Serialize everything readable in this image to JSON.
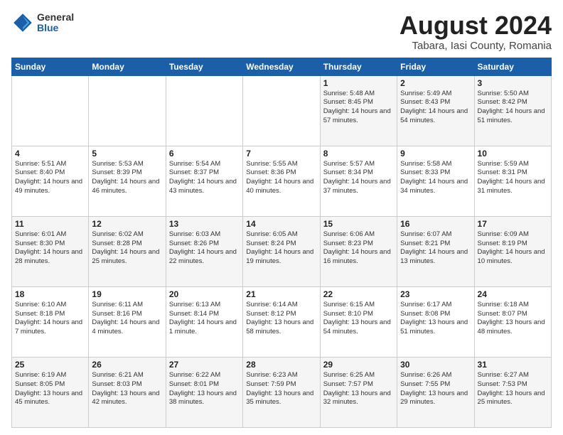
{
  "logo": {
    "general": "General",
    "blue": "Blue"
  },
  "title": {
    "main": "August 2024",
    "sub": "Tabara, Iasi County, Romania"
  },
  "days_of_week": [
    "Sunday",
    "Monday",
    "Tuesday",
    "Wednesday",
    "Thursday",
    "Friday",
    "Saturday"
  ],
  "weeks": [
    [
      {
        "day": "",
        "info": ""
      },
      {
        "day": "",
        "info": ""
      },
      {
        "day": "",
        "info": ""
      },
      {
        "day": "",
        "info": ""
      },
      {
        "day": "1",
        "info": "Sunrise: 5:48 AM\nSunset: 8:45 PM\nDaylight: 14 hours\nand 57 minutes."
      },
      {
        "day": "2",
        "info": "Sunrise: 5:49 AM\nSunset: 8:43 PM\nDaylight: 14 hours\nand 54 minutes."
      },
      {
        "day": "3",
        "info": "Sunrise: 5:50 AM\nSunset: 8:42 PM\nDaylight: 14 hours\nand 51 minutes."
      }
    ],
    [
      {
        "day": "4",
        "info": "Sunrise: 5:51 AM\nSunset: 8:40 PM\nDaylight: 14 hours\nand 49 minutes."
      },
      {
        "day": "5",
        "info": "Sunrise: 5:53 AM\nSunset: 8:39 PM\nDaylight: 14 hours\nand 46 minutes."
      },
      {
        "day": "6",
        "info": "Sunrise: 5:54 AM\nSunset: 8:37 PM\nDaylight: 14 hours\nand 43 minutes."
      },
      {
        "day": "7",
        "info": "Sunrise: 5:55 AM\nSunset: 8:36 PM\nDaylight: 14 hours\nand 40 minutes."
      },
      {
        "day": "8",
        "info": "Sunrise: 5:57 AM\nSunset: 8:34 PM\nDaylight: 14 hours\nand 37 minutes."
      },
      {
        "day": "9",
        "info": "Sunrise: 5:58 AM\nSunset: 8:33 PM\nDaylight: 14 hours\nand 34 minutes."
      },
      {
        "day": "10",
        "info": "Sunrise: 5:59 AM\nSunset: 8:31 PM\nDaylight: 14 hours\nand 31 minutes."
      }
    ],
    [
      {
        "day": "11",
        "info": "Sunrise: 6:01 AM\nSunset: 8:30 PM\nDaylight: 14 hours\nand 28 minutes."
      },
      {
        "day": "12",
        "info": "Sunrise: 6:02 AM\nSunset: 8:28 PM\nDaylight: 14 hours\nand 25 minutes."
      },
      {
        "day": "13",
        "info": "Sunrise: 6:03 AM\nSunset: 8:26 PM\nDaylight: 14 hours\nand 22 minutes."
      },
      {
        "day": "14",
        "info": "Sunrise: 6:05 AM\nSunset: 8:24 PM\nDaylight: 14 hours\nand 19 minutes."
      },
      {
        "day": "15",
        "info": "Sunrise: 6:06 AM\nSunset: 8:23 PM\nDaylight: 14 hours\nand 16 minutes."
      },
      {
        "day": "16",
        "info": "Sunrise: 6:07 AM\nSunset: 8:21 PM\nDaylight: 14 hours\nand 13 minutes."
      },
      {
        "day": "17",
        "info": "Sunrise: 6:09 AM\nSunset: 8:19 PM\nDaylight: 14 hours\nand 10 minutes."
      }
    ],
    [
      {
        "day": "18",
        "info": "Sunrise: 6:10 AM\nSunset: 8:18 PM\nDaylight: 14 hours\nand 7 minutes."
      },
      {
        "day": "19",
        "info": "Sunrise: 6:11 AM\nSunset: 8:16 PM\nDaylight: 14 hours\nand 4 minutes."
      },
      {
        "day": "20",
        "info": "Sunrise: 6:13 AM\nSunset: 8:14 PM\nDaylight: 14 hours\nand 1 minute."
      },
      {
        "day": "21",
        "info": "Sunrise: 6:14 AM\nSunset: 8:12 PM\nDaylight: 13 hours\nand 58 minutes."
      },
      {
        "day": "22",
        "info": "Sunrise: 6:15 AM\nSunset: 8:10 PM\nDaylight: 13 hours\nand 54 minutes."
      },
      {
        "day": "23",
        "info": "Sunrise: 6:17 AM\nSunset: 8:08 PM\nDaylight: 13 hours\nand 51 minutes."
      },
      {
        "day": "24",
        "info": "Sunrise: 6:18 AM\nSunset: 8:07 PM\nDaylight: 13 hours\nand 48 minutes."
      }
    ],
    [
      {
        "day": "25",
        "info": "Sunrise: 6:19 AM\nSunset: 8:05 PM\nDaylight: 13 hours\nand 45 minutes."
      },
      {
        "day": "26",
        "info": "Sunrise: 6:21 AM\nSunset: 8:03 PM\nDaylight: 13 hours\nand 42 minutes."
      },
      {
        "day": "27",
        "info": "Sunrise: 6:22 AM\nSunset: 8:01 PM\nDaylight: 13 hours\nand 38 minutes."
      },
      {
        "day": "28",
        "info": "Sunrise: 6:23 AM\nSunset: 7:59 PM\nDaylight: 13 hours\nand 35 minutes."
      },
      {
        "day": "29",
        "info": "Sunrise: 6:25 AM\nSunset: 7:57 PM\nDaylight: 13 hours\nand 32 minutes."
      },
      {
        "day": "30",
        "info": "Sunrise: 6:26 AM\nSunset: 7:55 PM\nDaylight: 13 hours\nand 29 minutes."
      },
      {
        "day": "31",
        "info": "Sunrise: 6:27 AM\nSunset: 7:53 PM\nDaylight: 13 hours\nand 25 minutes."
      }
    ]
  ]
}
